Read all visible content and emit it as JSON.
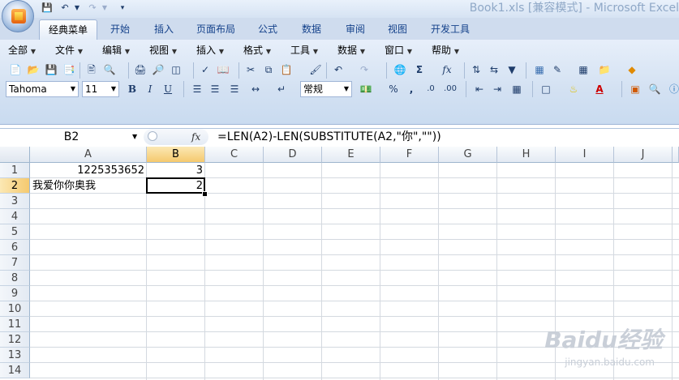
{
  "window": {
    "title": "Book1.xls  [兼容模式] - Microsoft Excel"
  },
  "ribbon": {
    "tabs": [
      {
        "label": "经典菜单",
        "active": true
      },
      {
        "label": "开始"
      },
      {
        "label": "插入"
      },
      {
        "label": "页面布局"
      },
      {
        "label": "公式"
      },
      {
        "label": "数据"
      },
      {
        "label": "审阅"
      },
      {
        "label": "视图"
      },
      {
        "label": "开发工具"
      }
    ],
    "menus": [
      "全部",
      "文件",
      "编辑",
      "视图",
      "插入",
      "格式",
      "工具",
      "数据",
      "窗口",
      "帮助"
    ],
    "font_name": "Tahoma",
    "font_size": "11",
    "bold_label": "B",
    "italic_label": "I",
    "underline_label": "U",
    "number_format": "常规",
    "percent_label": "%",
    "comma_label": ",",
    "sum_label": "Σ",
    "fx_label": "fx"
  },
  "formula_bar": {
    "name_box": "B2",
    "fx_label": "fx",
    "formula": "=LEN(A2)-LEN(SUBSTITUTE(A2,\"你\",\"\"))"
  },
  "sheet": {
    "columns": [
      "A",
      "B",
      "C",
      "D",
      "E",
      "F",
      "G",
      "H",
      "I",
      "J"
    ],
    "rows": [
      "1",
      "2",
      "3",
      "4",
      "5",
      "6",
      "7",
      "8",
      "9",
      "10",
      "11",
      "12",
      "13",
      "14"
    ],
    "cells": {
      "A1": "1225353652",
      "B1": "3",
      "A2": "我爱你你奥我",
      "B2": "2"
    },
    "selected_cell": "B2"
  },
  "watermark": {
    "text": "Baidu经验",
    "sub": "jingyan.baidu.com"
  }
}
